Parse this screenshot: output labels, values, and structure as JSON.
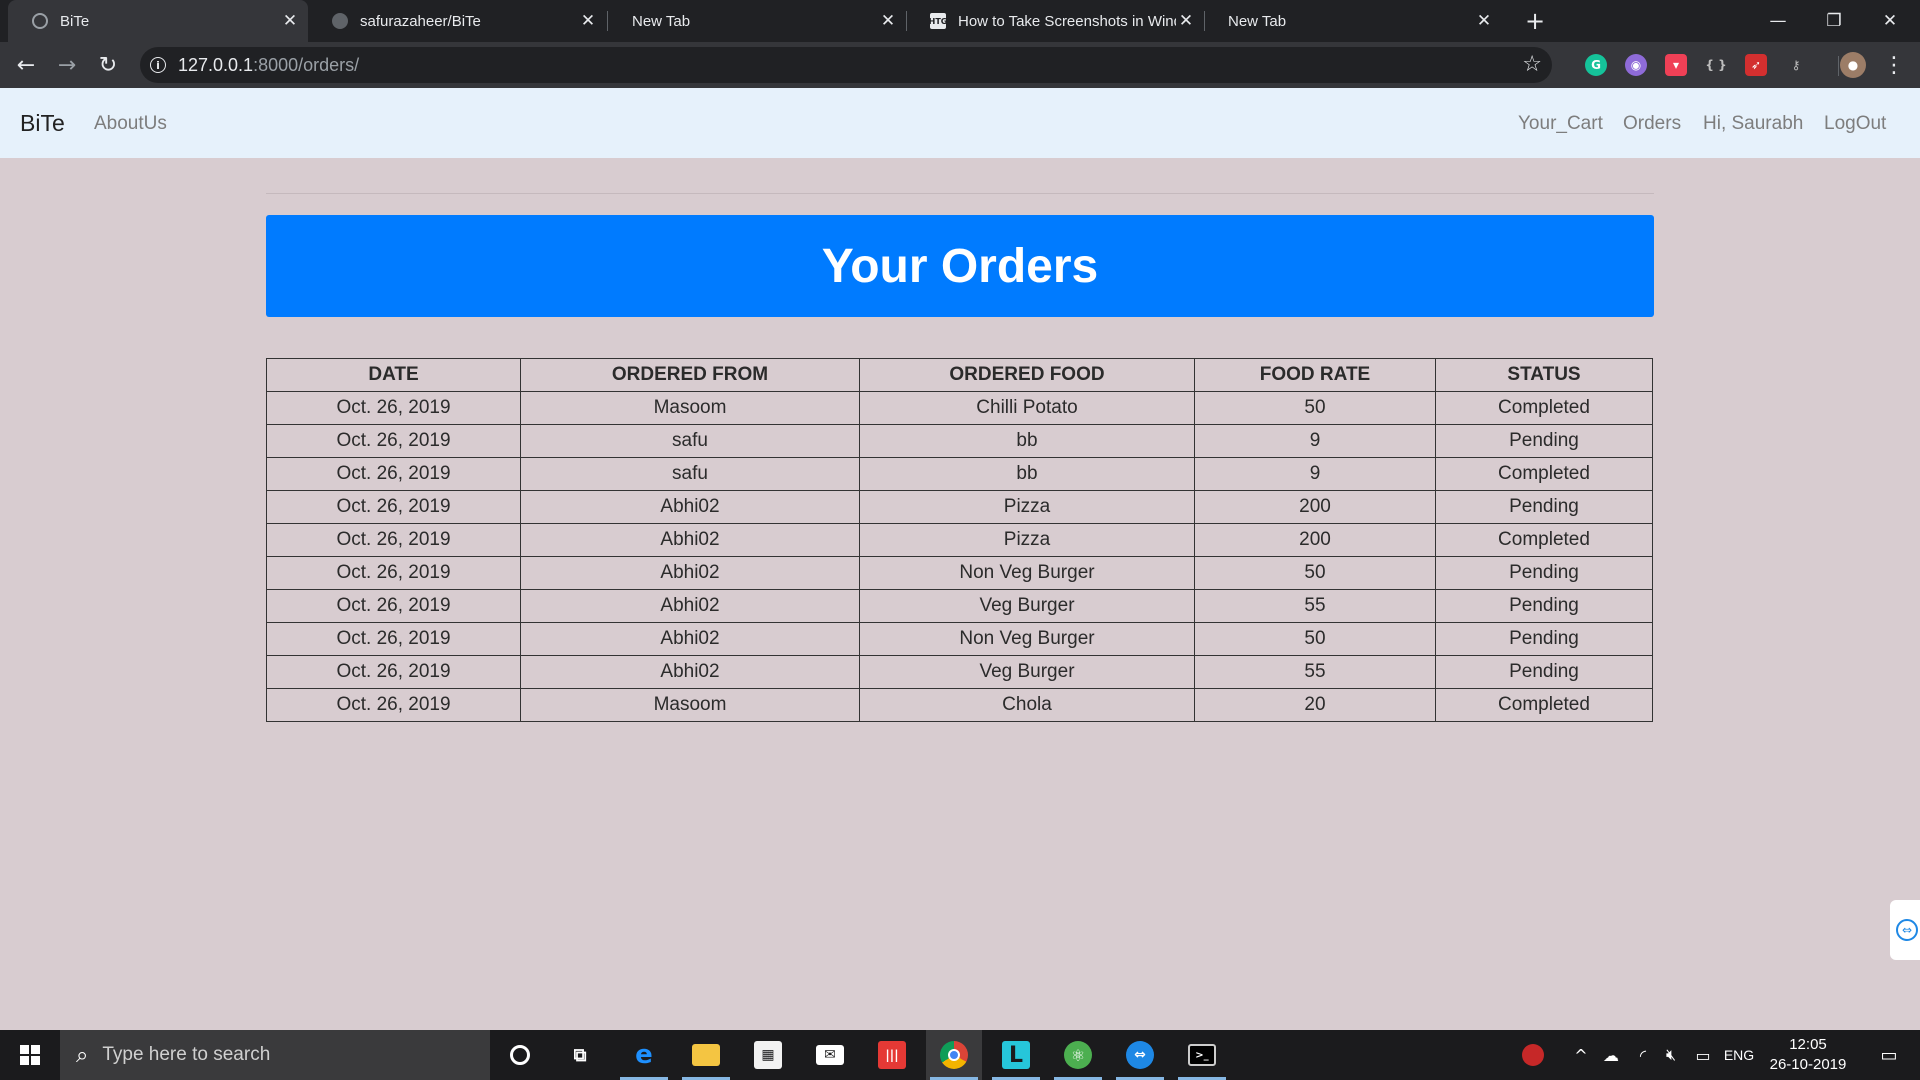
{
  "browser": {
    "tabs": [
      {
        "title": "BiTe",
        "active": true,
        "icon": "globe-icon"
      },
      {
        "title": "safurazaheer/BiTe",
        "active": false,
        "icon": "github-icon"
      },
      {
        "title": "New Tab",
        "active": false,
        "icon": ""
      },
      {
        "title": "How to Take Screenshots in Wind",
        "active": false,
        "icon": "htg-icon",
        "icon_text": "HTG"
      },
      {
        "title": "New Tab",
        "active": false,
        "icon": ""
      }
    ],
    "url_host": "127.0.0.1",
    "url_path": ":8000/orders/",
    "extensions": [
      "grammarly-icon",
      "extension-icon",
      "pocket-icon",
      "braces-icon",
      "rocket-icon",
      "key-icon"
    ]
  },
  "site": {
    "brand": "BiTe",
    "nav_left": [
      "AboutUs"
    ],
    "nav_right": [
      "Your_Cart",
      "Orders",
      "Hi, Saurabh",
      "LogOut"
    ],
    "banner_title": "Your Orders"
  },
  "orders": {
    "columns": [
      "DATE",
      "ORDERED FROM",
      "ORDERED FOOD",
      "FOOD RATE",
      "STATUS"
    ],
    "rows": [
      [
        "Oct. 26, 2019",
        "Masoom",
        "Chilli Potato",
        "50",
        "Completed"
      ],
      [
        "Oct. 26, 2019",
        "safu",
        "bb",
        "9",
        "Pending"
      ],
      [
        "Oct. 26, 2019",
        "safu",
        "bb",
        "9",
        "Completed"
      ],
      [
        "Oct. 26, 2019",
        "Abhi02",
        "Pizza",
        "200",
        "Pending"
      ],
      [
        "Oct. 26, 2019",
        "Abhi02",
        "Pizza",
        "200",
        "Completed"
      ],
      [
        "Oct. 26, 2019",
        "Abhi02",
        "Non Veg Burger",
        "50",
        "Pending"
      ],
      [
        "Oct. 26, 2019",
        "Abhi02",
        "Veg Burger",
        "55",
        "Pending"
      ],
      [
        "Oct. 26, 2019",
        "Abhi02",
        "Non Veg Burger",
        "50",
        "Pending"
      ],
      [
        "Oct. 26, 2019",
        "Abhi02",
        "Veg Burger",
        "55",
        "Pending"
      ],
      [
        "Oct. 26, 2019",
        "Masoom",
        "Chola",
        "20",
        "Completed"
      ]
    ]
  },
  "taskbar": {
    "search_placeholder": "Type here to search",
    "apps": [
      "cortana-icon",
      "task-view-icon",
      "edge-icon",
      "file-explorer-icon",
      "store-icon",
      "mail-icon",
      "app-red-icon",
      "chrome-icon",
      "app-l-icon",
      "atom-icon",
      "teamviewer-icon",
      "terminal-icon"
    ],
    "language": "ENG",
    "time": "12:05",
    "date": "26-10-2019"
  },
  "colors": {
    "page_bg": "#d8ccd0",
    "navbar_bg": "#e6f1fb",
    "banner_bg": "#007bff",
    "chrome_dark": "#202124",
    "taskbar_bg": "#1b1b1d"
  }
}
